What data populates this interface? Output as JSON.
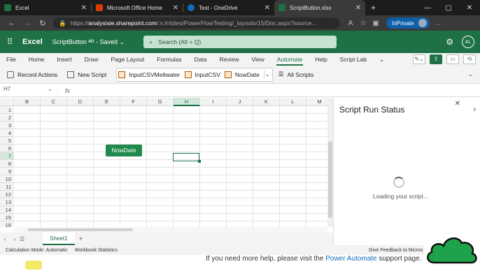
{
  "browser": {
    "tabs": [
      {
        "title": "Excel",
        "favicon_color": "#1e7145",
        "active": false
      },
      {
        "title": "Microsoft Office Home",
        "favicon_color": "#d83b01",
        "active": false
      },
      {
        "title": "Test - OneDrive",
        "favicon_color": "#0f6cbd",
        "active": false
      },
      {
        "title": "ScriptButton.xlsx",
        "favicon_color": "#1e7145",
        "active": true
      }
    ],
    "url_prefix": "https://",
    "url_host": "analysisie.sharepoint.com",
    "url_path": "/:x:/r/sites/PowerFlowTesting/_layouts/15/Doc.aspx?source...",
    "inprivate_label": "InPrivate"
  },
  "app": {
    "name": "Excel",
    "document": "ScriptButton",
    "save_status": "Saved",
    "search_placeholder": "Search (Alt + Q)",
    "avatar_initials": "AL"
  },
  "ribbon": {
    "tabs": [
      "File",
      "Home",
      "Insert",
      "Draw",
      "Page Layout",
      "Formulas",
      "Data",
      "Review",
      "View",
      "Automate",
      "Help",
      "Script Lab"
    ],
    "active_tab": "Automate",
    "commands": {
      "record_actions": "Record Actions",
      "new_script": "New Script",
      "scripts": [
        "InputCSVMeltwater",
        "InputCSV",
        "NowDate"
      ],
      "all_scripts": "All Scripts"
    }
  },
  "formula": {
    "name_box": "H7",
    "fx": "fx",
    "value": ""
  },
  "grid": {
    "columns": [
      "B",
      "C",
      "D",
      "E",
      "F",
      "G",
      "H",
      "I",
      "J",
      "K",
      "L",
      "M"
    ],
    "rows": [
      "1",
      "2",
      "3",
      "4",
      "5",
      "6",
      "7",
      "8",
      "9",
      "10",
      "11",
      "12",
      "13",
      "14",
      "15",
      "16"
    ],
    "selected_column": "H",
    "selected_row": "7",
    "button_label": "NowDate"
  },
  "sheets": {
    "tabs": [
      "Sheet1"
    ],
    "active": "Sheet1"
  },
  "status": {
    "calc_mode": "Calculation Mode: Automatic",
    "workbook_stats": "Workbook Statistics",
    "feedback": "Give Feedback to Micros"
  },
  "panel": {
    "title": "Script Run Status",
    "loading_text": "Loading your script..."
  },
  "footer": {
    "hint_before": "If you need more help, please visit the",
    "hint_link": "Power Automate",
    "hint_after": "support page."
  }
}
